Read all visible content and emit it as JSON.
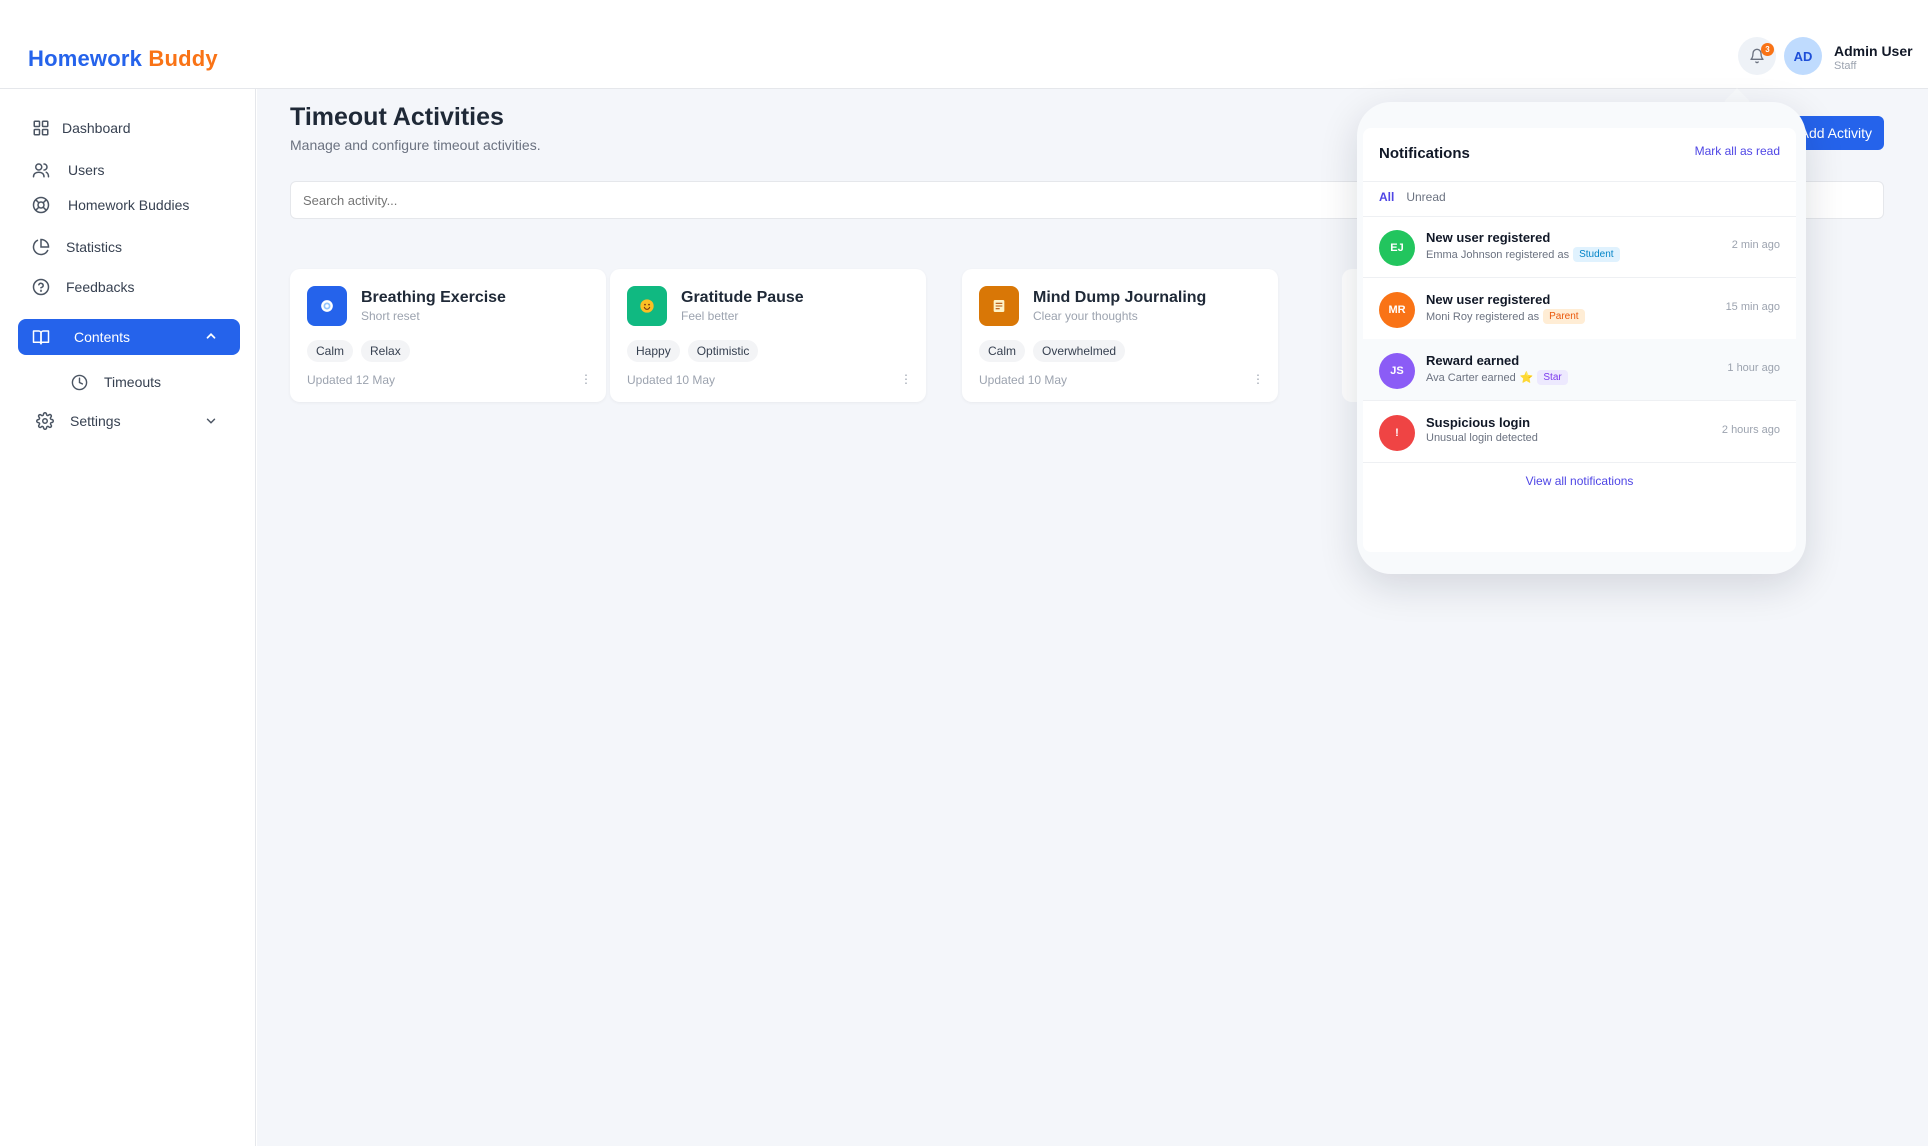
{
  "header": {
    "logo_part1": "Homework",
    "logo_part2": "Buddy",
    "notification_count": "3",
    "user_initials": "AD",
    "user_name": "Admin User",
    "user_role": "Staff"
  },
  "sidebar": {
    "items": [
      {
        "label": "Dashboard",
        "icon": "grid-icon"
      },
      {
        "label": "Users",
        "icon": "users-icon"
      },
      {
        "label": "Homework Buddies",
        "icon": "lifebuoy-icon"
      },
      {
        "label": "Statistics",
        "icon": "pie-chart-icon"
      },
      {
        "label": "Feedbacks",
        "icon": "help-circle-icon"
      },
      {
        "label": "Contents",
        "icon": "book-icon",
        "active": true,
        "expanded": true
      },
      {
        "label": "Timeouts",
        "icon": "clock-icon",
        "sub": true
      },
      {
        "label": "Settings",
        "icon": "gear-icon",
        "expanded": false
      }
    ]
  },
  "main": {
    "title": "Timeout Activities",
    "subtitle": "Manage and configure timeout activities.",
    "add_button": "Add Activity",
    "search_placeholder": "Search activity...",
    "cards": [
      {
        "title": "Breathing Exercise",
        "subtitle": "Short reset",
        "tags": [
          "Calm",
          "Relax"
        ],
        "updated": "Updated 12 May",
        "icon": "breathing-icon",
        "color": "#2563eb"
      },
      {
        "title": "Gratitude Pause",
        "subtitle": "Feel better",
        "tags": [
          "Happy",
          "Optimistic"
        ],
        "updated": "Updated 10 May",
        "icon": "smile-icon",
        "color": "#10b981"
      },
      {
        "title": "Mind Dump Journaling",
        "subtitle": "Clear your thoughts",
        "tags": [
          "Calm",
          "Overwhelmed"
        ],
        "updated": "Updated 10 May",
        "icon": "notepad-icon",
        "color": "#d97706"
      }
    ],
    "more_glyph": "⋮"
  },
  "notifications": {
    "title": "Notifications",
    "mark_all": "Mark all as read",
    "tab_all": "All",
    "tab_unread": "Unread",
    "items": [
      {
        "initials": "EJ",
        "color": "#22c55e",
        "title": "New user registered",
        "body": "Emma Johnson registered as",
        "pill": "Student",
        "time": "2 min ago"
      },
      {
        "initials": "MR",
        "color": "#f97316",
        "title": "New user registered",
        "body": "Moni Roy registered as",
        "pill": "Parent",
        "time": "15 min ago"
      },
      {
        "initials": "JS",
        "color": "#8b5cf6",
        "title": "Reward earned",
        "body": "Ava Carter earned",
        "emoji": "⭐",
        "pill": "Star",
        "time": "1 hour ago"
      },
      {
        "initials": "!",
        "color": "#ef4444",
        "title": "Suspicious login",
        "body": "Unusual login detected",
        "time": "2 hours ago"
      }
    ],
    "view_all": "View all notifications"
  }
}
